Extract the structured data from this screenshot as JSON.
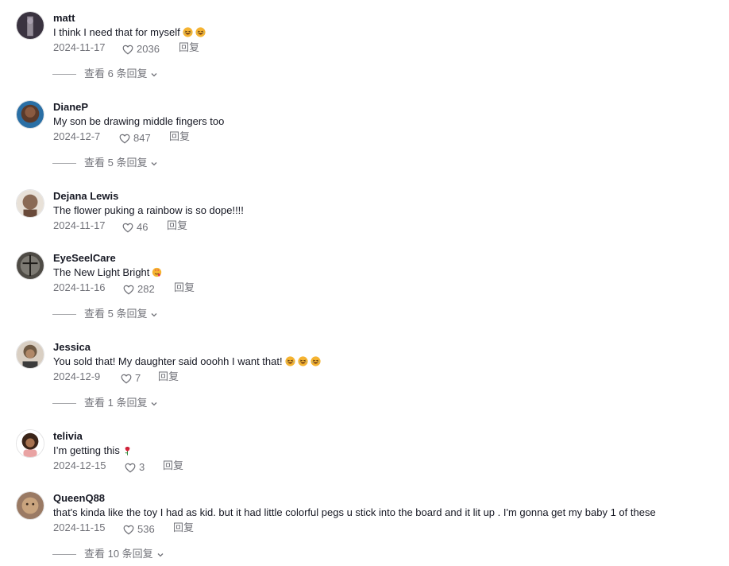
{
  "comments": [
    {
      "username": "matt",
      "text": "I think I need that for myself",
      "emojis": [
        "laugh",
        "laugh"
      ],
      "date": "2024-11-17",
      "likes": "2036",
      "reply_label": "回复",
      "replies_label": "查看 6 条回复",
      "avatar_color": "#3a3340"
    },
    {
      "username": "DianeP",
      "text": "My son be drawing middle fingers too",
      "emojis": [],
      "date": "2024-12-7",
      "likes": "847",
      "reply_label": "回复",
      "replies_label": "查看 5 条回复",
      "avatar_color": "#2a6fa5"
    },
    {
      "username": "Dejana Lewis",
      "text": "The flower puking a rainbow is so dope!!!!",
      "emojis": [],
      "date": "2024-11-17",
      "likes": "46",
      "reply_label": "回复",
      "replies_label": null,
      "avatar_color": "#8a6a55"
    },
    {
      "username": "EyeSeelCare",
      "text": "The New Light Bright",
      "emojis": [
        "heart-face"
      ],
      "date": "2024-11-16",
      "likes": "282",
      "reply_label": "回复",
      "replies_label": "查看 5 条回复",
      "avatar_color": "#4e4b45"
    },
    {
      "username": "Jessica",
      "text": "You sold that! My daughter said ooohh I want that!",
      "emojis": [
        "laugh",
        "laugh",
        "laugh"
      ],
      "date": "2024-12-9",
      "likes": "7",
      "reply_label": "回复",
      "replies_label": "查看 1 条回复",
      "avatar_color": "#6f5a44"
    },
    {
      "username": "telivia",
      "text": "I’m getting this",
      "emojis": [
        "rose"
      ],
      "date": "2024-12-15",
      "likes": "3",
      "reply_label": "回复",
      "replies_label": null,
      "avatar_color": "#e9a3a3"
    },
    {
      "username": "QueenQ88",
      "text": "that's kinda like the toy I had as kid. but it had little colorful pegs u stick into the board and it lit up . I'm gonna get my baby 1 of these",
      "emojis": [],
      "date": "2024-11-15",
      "likes": "536",
      "reply_label": "回复",
      "replies_label": "查看 10 条回复",
      "avatar_color": "#9a7a64"
    }
  ],
  "colors": {
    "text_primary": "#161823",
    "text_secondary": "#7a7b80",
    "emoji_laugh": "#f5b331",
    "emoji_heart": "#e8334a",
    "emoji_rose": "#d8233b"
  },
  "icons": {
    "like": "heart-outline-icon",
    "expand": "chevron-down-icon"
  }
}
